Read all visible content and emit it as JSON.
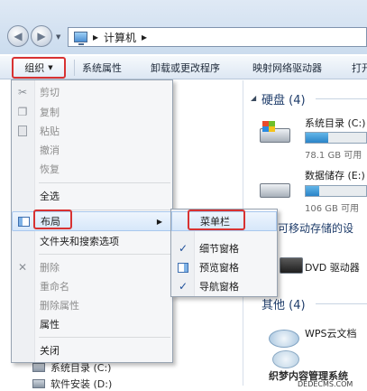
{
  "address": {
    "sep1": "▸",
    "location": "计算机",
    "sep2": "▸"
  },
  "toolbar": {
    "organize": "组织",
    "organize_arrow": "▼",
    "items": [
      "系统属性",
      "卸载或更改程序",
      "映射网络驱动器",
      "打开"
    ]
  },
  "organize_menu": {
    "items": [
      {
        "label": "剪切",
        "icon": "scissors-icon",
        "glyph": "✂",
        "enabled": false
      },
      {
        "label": "复制",
        "icon": "copy-icon",
        "glyph": "❐",
        "enabled": false
      },
      {
        "label": "粘贴",
        "icon": "paste-icon",
        "glyph": "📋",
        "enabled": false
      },
      {
        "label": "撤消",
        "enabled": false
      },
      {
        "label": "恢复",
        "enabled": false
      },
      {
        "label": "全选",
        "enabled": true
      },
      {
        "label": "布局",
        "icon": "layout-icon",
        "submenu": true,
        "highlighted": true,
        "enabled": true
      },
      {
        "label": "文件夹和搜索选项",
        "enabled": true
      },
      {
        "label": "删除",
        "icon": "delete-icon",
        "glyph": "✕",
        "enabled": false
      },
      {
        "label": "重命名",
        "enabled": false
      },
      {
        "label": "删除属性",
        "enabled": false
      },
      {
        "label": "属性",
        "enabled": true
      },
      {
        "label": "关闭",
        "enabled": true
      }
    ],
    "submenu_arrow": "▶"
  },
  "layout_submenu": {
    "items": [
      {
        "label": "菜单栏",
        "checked": false,
        "highlighted": true
      },
      {
        "label": "细节窗格",
        "checked": true
      },
      {
        "label": "预览窗格",
        "checked": false,
        "icon": "preview-pane-icon"
      },
      {
        "label": "导航窗格",
        "checked": true
      }
    ],
    "check_glyph": "✓"
  },
  "content": {
    "hard_disks_title": "硬盘 (4)",
    "drives": [
      {
        "name": "系统目录 (C:)",
        "free": "78.1 GB 可用",
        "used_fraction": 0.38
      },
      {
        "name": "数据储存 (E:)",
        "free": "106 GB 可用",
        "used_fraction": 0.22
      }
    ],
    "removable_title": "可移动存储的设",
    "dvd": "DVD 驱动器",
    "other_title": "其他 (4)",
    "other_item": "WPS云文档"
  },
  "navpane": {
    "items": [
      {
        "label": "系统目录 (C:)"
      },
      {
        "label": "软件安装 (D:)"
      }
    ]
  },
  "watermark": {
    "line1": "织梦内容管理系统",
    "line2": "DEDECMS.COM"
  },
  "colors": {
    "annotation_red": "#d83232",
    "accent_blue": "#2a84c8"
  }
}
